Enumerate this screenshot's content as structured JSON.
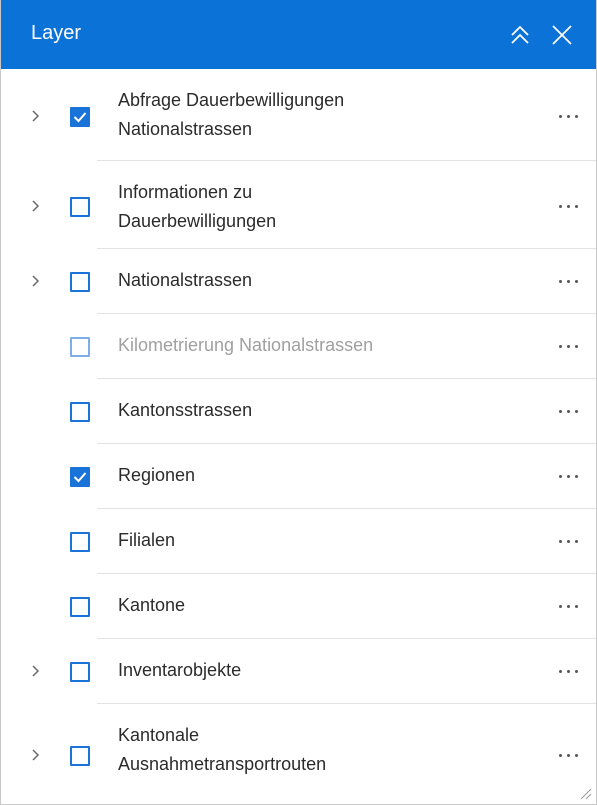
{
  "panel": {
    "title": "Layer",
    "accent_color": "#0b72d8",
    "header_icons": [
      "double-chevron-up-icon",
      "close-icon"
    ]
  },
  "layers": [
    {
      "lines": [
        "Abfrage Dauerbewilligungen",
        "Nationalstrassen"
      ],
      "checked": true,
      "expandable": true,
      "disabled": false
    },
    {
      "lines": [
        "Informationen zu",
        "Dauerbewilligungen"
      ],
      "checked": false,
      "expandable": true,
      "disabled": false
    },
    {
      "lines": [
        "Nationalstrassen"
      ],
      "checked": false,
      "expandable": true,
      "disabled": false
    },
    {
      "lines": [
        "Kilometrierung Nationalstrassen"
      ],
      "checked": false,
      "expandable": false,
      "disabled": true
    },
    {
      "lines": [
        "Kantonsstrassen"
      ],
      "checked": false,
      "expandable": false,
      "disabled": false
    },
    {
      "lines": [
        "Regionen"
      ],
      "checked": true,
      "expandable": false,
      "disabled": false
    },
    {
      "lines": [
        "Filialen"
      ],
      "checked": false,
      "expandable": false,
      "disabled": false
    },
    {
      "lines": [
        "Kantone"
      ],
      "checked": false,
      "expandable": false,
      "disabled": false
    },
    {
      "lines": [
        "Inventarobjekte"
      ],
      "checked": false,
      "expandable": true,
      "disabled": false
    },
    {
      "lines": [
        "Kantonale",
        "Ausnahmetransportrouten"
      ],
      "checked": false,
      "expandable": true,
      "disabled": false
    }
  ]
}
